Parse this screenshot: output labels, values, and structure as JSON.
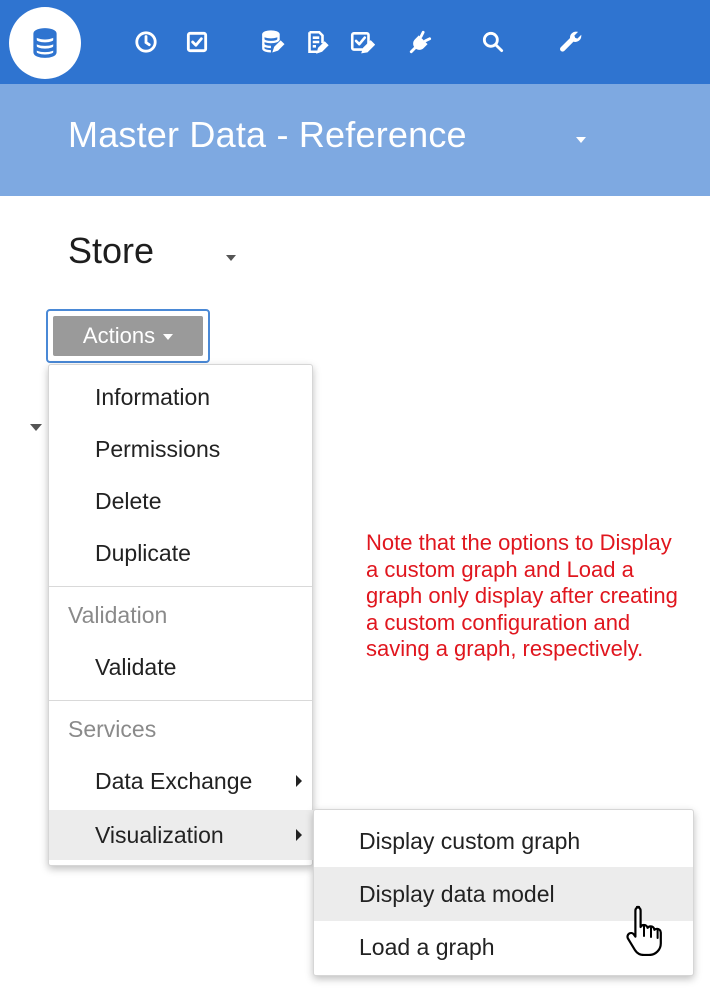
{
  "toolbar": {
    "icons": [
      {
        "name": "database-icon",
        "active": true
      },
      {
        "name": "clock-icon"
      },
      {
        "name": "checkbox-icon"
      },
      {
        "name": "database-edit-icon"
      },
      {
        "name": "document-edit-icon"
      },
      {
        "name": "checklist-edit-icon"
      },
      {
        "name": "plug-icon"
      },
      {
        "name": "search-icon"
      },
      {
        "name": "wrench-icon"
      }
    ],
    "color": "#2f74d0"
  },
  "header": {
    "title": "Master Data - Reference",
    "color": "#7ea9e1"
  },
  "store": {
    "title": "Store"
  },
  "actions": {
    "label": "Actions"
  },
  "menu": {
    "items": [
      {
        "label": "Information"
      },
      {
        "label": "Permissions"
      },
      {
        "label": "Delete"
      },
      {
        "label": "Duplicate"
      }
    ],
    "validation_header": "Validation",
    "validation_items": [
      {
        "label": "Validate"
      }
    ],
    "services_header": "Services",
    "services_items": [
      {
        "label": "Data Exchange"
      },
      {
        "label": "Visualization"
      }
    ]
  },
  "submenu": {
    "items": [
      {
        "label": "Display custom graph"
      },
      {
        "label": "Display data model"
      },
      {
        "label": "Load a graph"
      }
    ]
  },
  "note": {
    "text": "Note that the options to Display a custom graph and Load a graph only display after creating a custom configuration and saving a graph, respectively.",
    "color": "#e0161e"
  }
}
